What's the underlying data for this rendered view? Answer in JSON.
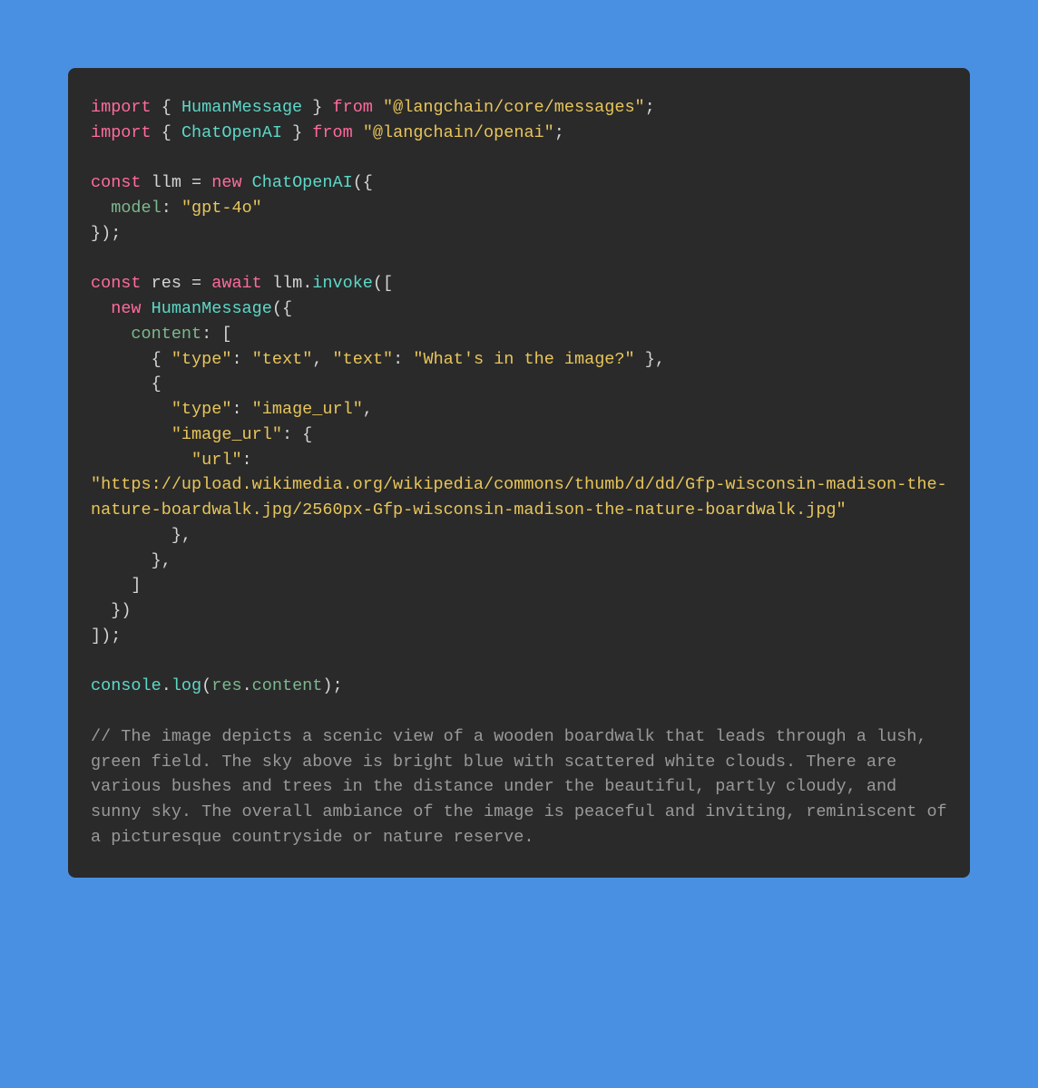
{
  "code": {
    "line1": {
      "import": "import",
      "brace_open": " { ",
      "humanMessage": "HumanMessage",
      "brace_close": " } ",
      "from": "from",
      "space": " ",
      "package1": "\"@langchain/core/messages\"",
      "semi": ";"
    },
    "line2": {
      "import": "import",
      "brace_open": " { ",
      "chatOpenAI": "ChatOpenAI",
      "brace_close": " } ",
      "from": "from",
      "space": " ",
      "package2": "\"@langchain/openai\"",
      "semi": ";"
    },
    "line4": {
      "const": "const",
      "llm": " llm ",
      "equals": "= ",
      "new": "new",
      "space": " ",
      "chatOpenAI": "ChatOpenAI",
      "paren": "({"
    },
    "line5": {
      "indent": "  ",
      "model": "model",
      "colon": ": ",
      "value": "\"gpt-4o\""
    },
    "line6": {
      "close": "});"
    },
    "line8": {
      "const": "const",
      "res": " res ",
      "equals": "= ",
      "await": "await",
      "llm": " llm",
      "dot": ".",
      "invoke": "invoke",
      "paren": "(["
    },
    "line9": {
      "indent": "  ",
      "new": "new",
      "space": " ",
      "humanMessage": "HumanMessage",
      "paren": "({"
    },
    "line10": {
      "indent": "    ",
      "content": "content",
      "colon": ": ["
    },
    "line11": {
      "indent": "      { ",
      "typeKey": "\"type\"",
      "colon1": ": ",
      "typeVal": "\"text\"",
      "comma": ", ",
      "textKey": "\"text\"",
      "colon2": ": ",
      "textVal": "\"What's in the image?\"",
      "close": " },"
    },
    "line12": {
      "indent": "      {"
    },
    "line13": {
      "indent": "        ",
      "typeKey": "\"type\"",
      "colon": ": ",
      "typeVal": "\"image_url\"",
      "comma": ","
    },
    "line14": {
      "indent": "        ",
      "imageUrlKey": "\"image_url\"",
      "colon": ": {"
    },
    "line15": {
      "indent": "          ",
      "urlKey": "\"url\"",
      "colon": ":"
    },
    "line16": {
      "url": "\"https://upload.wikimedia.org/wikipedia/commons/thumb/d/dd/Gfp-wisconsin-madison-the-nature-boardwalk.jpg/2560px-Gfp-wisconsin-madison-the-nature-boardwalk.jpg\""
    },
    "line17": {
      "indent": "        },"
    },
    "line18": {
      "indent": "      },"
    },
    "line19": {
      "indent": "    ]"
    },
    "line20": {
      "indent": "  })"
    },
    "line21": {
      "close": "]);"
    },
    "line23": {
      "console": "console",
      "dot1": ".",
      "log": "log",
      "paren1": "(",
      "res": "res",
      "dot2": ".",
      "content": "content",
      "paren2": ");"
    },
    "comment": "// The image depicts a scenic view of a wooden boardwalk that leads through a lush, green field. The sky above is bright blue with scattered white clouds. There are various bushes and trees in the distance under the beautiful, partly cloudy, and sunny sky. The overall ambiance of the image is peaceful and inviting, reminiscent of a picturesque countryside or nature reserve."
  }
}
